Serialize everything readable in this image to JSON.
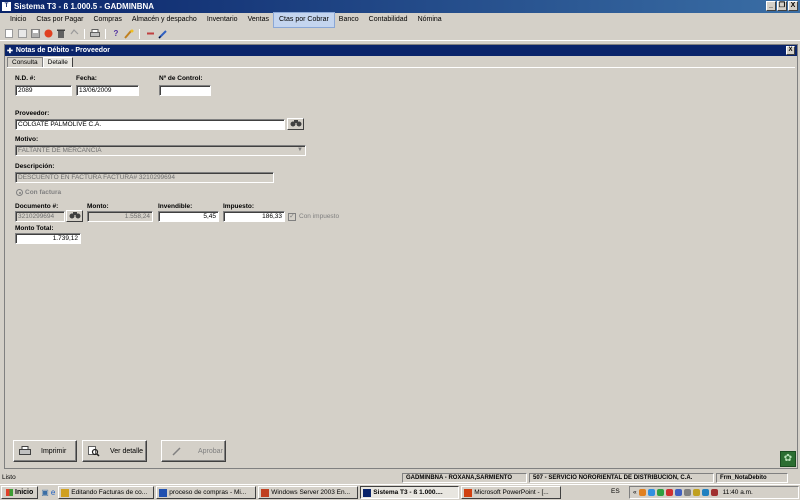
{
  "window": {
    "title": "Sistema T3 - ß 1.000.5 - GADMINBNA",
    "minimize": "_",
    "restore": "❐",
    "close": "X"
  },
  "menu": [
    "Inicio",
    "Ctas por Pagar",
    "Compras",
    "Almacén y despacho",
    "Inventario",
    "Ventas",
    "Ctas por Cobrar",
    "Banco",
    "Contabilidad",
    "Nómina"
  ],
  "menu_active": "Ctas por Cobrar",
  "child": {
    "title": "Notas de Débito - Proveedor",
    "close": "X",
    "tabs": [
      "Consulta",
      "Detalle"
    ],
    "active_tab": "Detalle"
  },
  "form": {
    "nd_label": "N.D. #:",
    "nd_value": "2089",
    "fecha_label": "Fecha:",
    "fecha_value": "13/06/2009",
    "control_label": "Nº de Control:",
    "control_value": "",
    "proveedor_label": "Proveedor:",
    "proveedor_value": "COLGATE PALMOLIVE C.A.",
    "motivo_label": "Motivo:",
    "motivo_value": "FALTANTE DE MERCANCÍA",
    "descripcion_label": "Descripción:",
    "descripcion_value": "DESCUENTO EN FACTURA FACTURA# 3210299694",
    "con_factura_label": "Con factura",
    "documento_label": "Documento #:",
    "documento_value": "3210299694",
    "monto_label": "Monto:",
    "monto_value": "1.558,24",
    "invendible_label": "Invendible:",
    "invendible_value": "5,45",
    "impuesto_label": "Impuesto:",
    "impuesto_value": "186,33",
    "con_impuesto_label": "Con impuesto",
    "monto_total_label": "Monto Total:",
    "monto_total_value": "1.739,12"
  },
  "actions": {
    "imprimir": "Imprimir",
    "ver_detalle": "Ver detalle",
    "aprobar": "Aprobar"
  },
  "status": {
    "ready": "Listo",
    "user": "GADMINBNA - ROXANA,SARMIENTO",
    "company": "507 - SERVICIO NORORIENTAL DE DISTRIBUCIÓN, C.A.",
    "form": "Frm_NotaDebito"
  },
  "taskbar": {
    "start": "Inicio",
    "tasks": [
      "Editando Facturas de co...",
      "proceso de compras - Mi...",
      "Windows Server 2003 En...",
      "Sistema T3 - ß 1.000....",
      "Microsoft PowerPoint - [..."
    ],
    "active_task_index": 3,
    "language": "ES",
    "tray_collapse": "«",
    "clock": "11:40 a.m."
  },
  "icons": {
    "binoculars": "binoculars-icon",
    "printer": "printer-icon",
    "magnifier": "magnifier-icon",
    "pen": "pen-icon"
  }
}
